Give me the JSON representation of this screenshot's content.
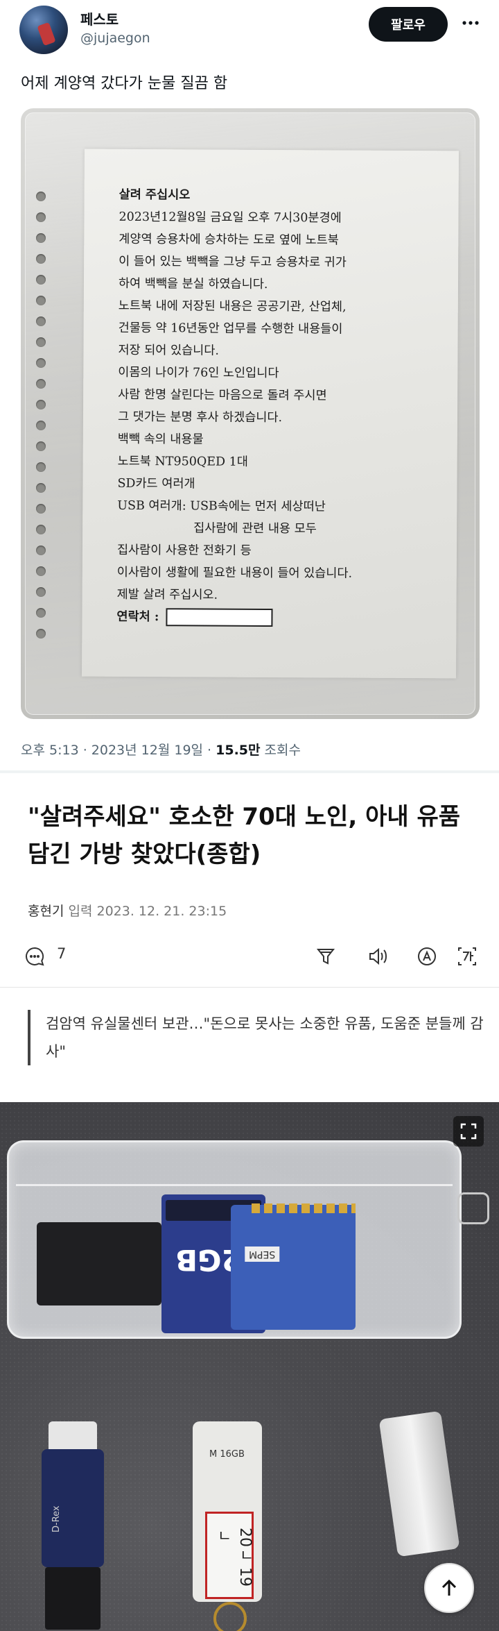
{
  "tweet": {
    "display_name": "페스토",
    "handle": "@jujaegon",
    "follow_label": "팔로우",
    "text": "어제 계양역 갔다가 눈물 질끔 함",
    "timestamp": "오후 5:13 · 2023년 12월 19일 · ",
    "views_value": "15.5만",
    "views_label": " 조회수"
  },
  "note": {
    "lines": [
      "살려 주십시오",
      "2023년12월8일 금요일 오후 7시30분경에",
      "계양역 승용차에 승차하는 도로 옆에 노트북",
      "이 들어 있는 백빽을 그냥 두고 승용차로 귀가",
      "하여 백빽을 분실 하였습니다.",
      "노트북 내에 저장된 내용은 공공기관, 산업체,",
      "건물등 약 16년동안 업무를 수행한 내용들이",
      "저장 되어 있습니다.",
      "이몸의 나이가 76인 노인입니다",
      "사람 한명 살린다는 마음으로 돌려 주시면",
      "그 댓가는 분명 후사 하겠습니다.",
      "백빽 속의 내용물",
      "노트북 NT950QED 1대",
      "SD카드 여러개",
      "USB 여러개: USB속에는 먼저 세상떠난",
      "집사람에 관련 내용 모두",
      "집사람이 사용한 전화기 등",
      "이사람이 생활에 필요한 내용이 들어 있습니다.",
      "제발 살려 주십시오."
    ],
    "contact_label": "연락처 :"
  },
  "article": {
    "headline": "\"살려주세요\" 호소한 70대 노인, 아내 유품 담긴 가방 찾았다(종합)",
    "author": "홍현기",
    "byline_rest": " 입력  2023. 12. 21. 23:15",
    "comment_count": "7",
    "subhead": "검암역 유실물센터 보관…\"돈으로 못사는 소중한 유품, 도움준 분들께 감사\""
  },
  "photo": {
    "sd_capacity": "2GB",
    "usb_capacity": "M 16GB",
    "usb_tag": "20ㄴ 19ㄴ",
    "usb_brand": "D-Rex",
    "sd2_label": "SEPM"
  },
  "icons": {
    "more": "more-dots-icon",
    "comment": "comment-bubble-icon",
    "summary": "summary-filter-icon",
    "listen": "speaker-icon",
    "font": "font-size-icon",
    "translate": "translate-icon",
    "expand": "expand-icon",
    "scroll_top": "arrow-up-icon"
  }
}
